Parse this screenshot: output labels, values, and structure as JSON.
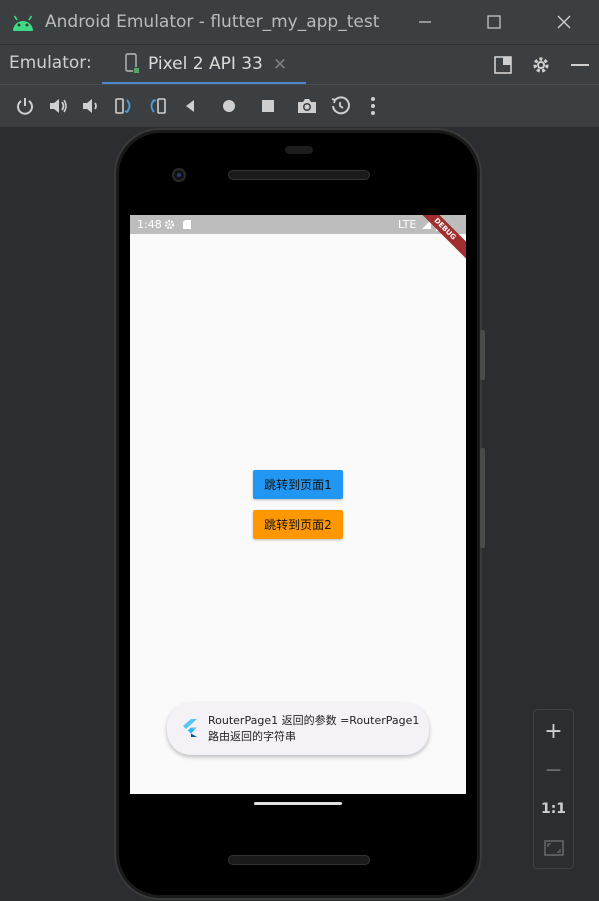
{
  "window": {
    "title": "Android Emulator - flutter_my_app_test"
  },
  "tabbar": {
    "label": "Emulator:",
    "tab_label": "Pixel 2 API 33",
    "tab_close": "×"
  },
  "statusbar": {
    "time": "1:48",
    "network": "LTE",
    "banner": "DEBUG"
  },
  "app": {
    "button1": "跳转到页面1",
    "button2": "跳转到页面2",
    "toast_line1": "RouterPage1 返回的参数 =RouterPage1",
    "toast_line2": "路由返回的字符串"
  },
  "zoom": {
    "zoom_in": "+",
    "zoom_out": "−",
    "actual_size": "1:1"
  },
  "colors": {
    "accent": "#4a88c7",
    "button1": "#2196f3",
    "button2": "#ff9800",
    "debug": "#a03030"
  },
  "icons": [
    "android-icon",
    "minimize-icon",
    "maximize-icon",
    "close-icon",
    "phone-icon",
    "layout-icon",
    "gear-icon",
    "collapse-icon",
    "power-icon",
    "volume-up-icon",
    "volume-down-icon",
    "rotate-left-icon",
    "rotate-right-icon",
    "back-icon",
    "home-icon",
    "overview-icon",
    "camera-icon",
    "snapshot-icon",
    "more-icon",
    "flutter-icon",
    "fit-screen-icon"
  ]
}
